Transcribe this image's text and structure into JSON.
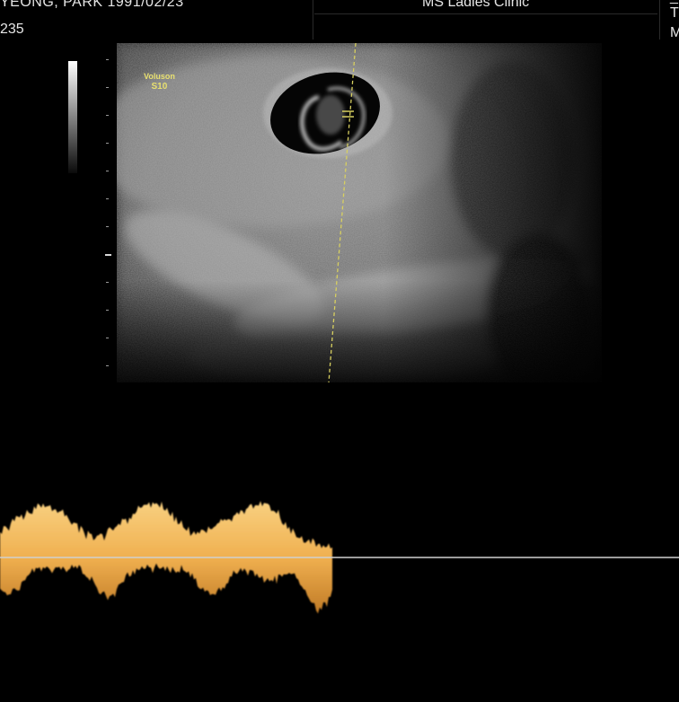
{
  "header": {
    "patient_name": "YEONG, PARK  1991/02/23",
    "patient_id": "235",
    "clinic": "MS Ladies Clinic",
    "right_chars": [
      "T",
      "M"
    ]
  },
  "probe": {
    "brand": "Voluson",
    "model": "S10"
  },
  "colors": {
    "background": "#000000",
    "annotation": "#e8e070",
    "mmode_wave": "#f0b050",
    "baseline": "#cfcfcf"
  },
  "icons": [
    "grayscale-bar",
    "focus-marker-icon",
    "depth-scale",
    "m-line-cursor"
  ]
}
